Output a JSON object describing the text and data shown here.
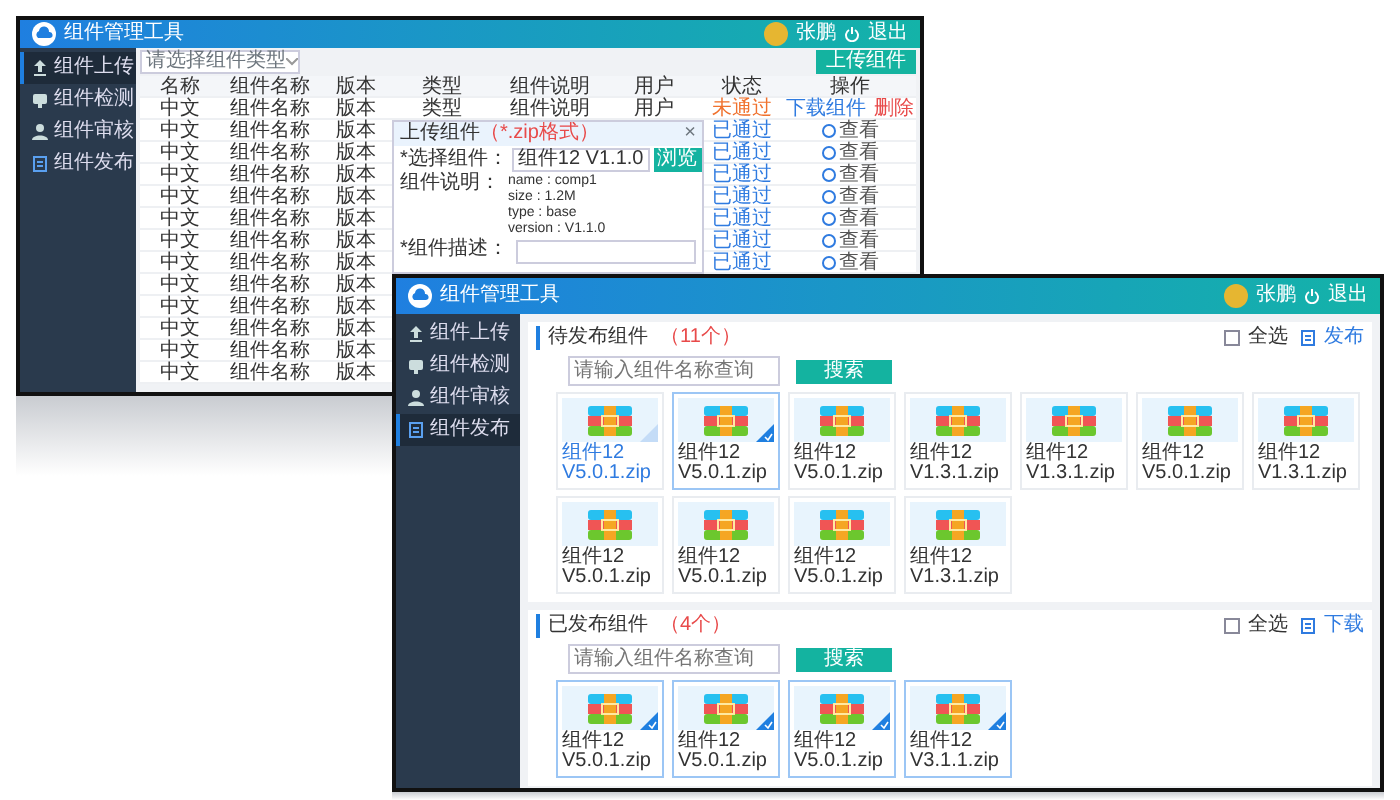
{
  "back_window": {
    "title": "组件管理工具",
    "user": "张鹏",
    "logout": "退出",
    "sidebar": [
      {
        "label": "组件上传",
        "selected": true
      },
      {
        "label": "组件检测",
        "selected": false
      },
      {
        "label": "组件审核",
        "selected": false
      },
      {
        "label": "组件发布",
        "selected": false
      }
    ],
    "filter": {
      "placeholder": "请选择组件类型"
    },
    "upload_button": "上传组件",
    "table": {
      "columns": [
        "名称",
        "组件名称",
        "版本",
        "类型",
        "组件说明",
        "用户",
        "状态",
        "操作"
      ],
      "rows": [
        {
          "no": "中文",
          "name": "组件名称",
          "version": "版本",
          "type": "类型",
          "desc": "组件说明",
          "user": "用户",
          "status": "未通过",
          "passed": false,
          "actions": [
            {
              "label": "下载组件",
              "kind": "link"
            },
            {
              "label": "删除",
              "kind": "danger"
            }
          ]
        },
        {
          "no": "中文",
          "name": "组件名称",
          "version": "版本",
          "status": "已通过",
          "passed": true,
          "actions": [
            {
              "label": "查看",
              "kind": "view"
            }
          ]
        },
        {
          "no": "中文",
          "name": "组件名称",
          "version": "版本",
          "status": "已通过",
          "passed": true,
          "actions": [
            {
              "label": "查看",
              "kind": "view"
            }
          ]
        },
        {
          "no": "中文",
          "name": "组件名称",
          "version": "版本",
          "status": "已通过",
          "passed": true,
          "actions": [
            {
              "label": "查看",
              "kind": "view"
            }
          ]
        },
        {
          "no": "中文",
          "name": "组件名称",
          "version": "版本",
          "status": "已通过",
          "passed": true,
          "actions": [
            {
              "label": "查看",
              "kind": "view"
            }
          ]
        },
        {
          "no": "中文",
          "name": "组件名称",
          "version": "版本",
          "status": "已通过",
          "passed": true,
          "actions": [
            {
              "label": "查看",
              "kind": "view"
            }
          ]
        },
        {
          "no": "中文",
          "name": "组件名称",
          "version": "版本",
          "status": "已通过",
          "passed": true,
          "actions": [
            {
              "label": "查看",
              "kind": "view"
            }
          ]
        },
        {
          "no": "中文",
          "name": "组件名称",
          "version": "版本",
          "status": "已通过",
          "passed": true,
          "actions": [
            {
              "label": "查看",
              "kind": "view"
            }
          ]
        },
        {
          "no": "中文",
          "name": "组件名称",
          "version": "版本"
        },
        {
          "no": "中文",
          "name": "组件名称",
          "version": "版本"
        },
        {
          "no": "中文",
          "name": "组件名称",
          "version": "版本"
        },
        {
          "no": "中文",
          "name": "组件名称",
          "version": "版本"
        },
        {
          "no": "中文",
          "name": "组件名称",
          "version": "版本"
        }
      ]
    },
    "dialog": {
      "title": "上传组件",
      "hint": "（*.zip格式）",
      "close": "×",
      "file_label": "*选择组件：",
      "file_value": "组件12 V1.1.0",
      "browse": "浏览",
      "info_label": "组件说明：",
      "info_lines": [
        "name : comp1",
        "size : 1.2M",
        "type : base",
        "version : V1.1.0"
      ],
      "desc_label": "*组件描述："
    }
  },
  "front_window": {
    "title": "组件管理工具",
    "user": "张鹏",
    "logout": "退出",
    "sidebar": [
      {
        "label": "组件上传",
        "selected": false
      },
      {
        "label": "组件检测",
        "selected": false
      },
      {
        "label": "组件审核",
        "selected": false
      },
      {
        "label": "组件发布",
        "selected": true
      }
    ],
    "sections": [
      {
        "title": "待发布组件",
        "count": "（11个）",
        "select_all": {
          "label": "全选",
          "checked": false
        },
        "action": "发布",
        "search": {
          "placeholder": "请输入组件名称查询"
        },
        "search_button": "搜索",
        "items": [
          {
            "label": "组件12 V5.0.1.zip",
            "hovered": true,
            "selected": false
          },
          {
            "label": "组件12 V5.0.1.zip",
            "hovered": false,
            "selected": true
          },
          {
            "label": "组件12 V5.0.1.zip",
            "hovered": false,
            "selected": false
          },
          {
            "label": "组件12 V1.3.1.zip",
            "hovered": false,
            "selected": false
          },
          {
            "label": "组件12 V1.3.1.zip",
            "hovered": false,
            "selected": false
          },
          {
            "label": "组件12 V5.0.1.zip",
            "hovered": false,
            "selected": false
          },
          {
            "label": "组件12 V1.3.1.zip",
            "hovered": false,
            "selected": false
          },
          {
            "label": "组件12 V5.0.1.zip",
            "hovered": false,
            "selected": false
          },
          {
            "label": "组件12 V5.0.1.zip",
            "hovered": false,
            "selected": false
          },
          {
            "label": "组件12 V5.0.1.zip",
            "hovered": false,
            "selected": false
          },
          {
            "label": "组件12 V1.3.1.zip",
            "hovered": false,
            "selected": false
          }
        ]
      },
      {
        "title": "已发布组件",
        "count": "（4个）",
        "select_all": {
          "label": "全选",
          "checked": false
        },
        "action": "下载",
        "search": {
          "placeholder": "请输入组件名称查询"
        },
        "search_button": "搜索",
        "items": [
          {
            "label": "组件12 V5.0.1.zip",
            "hovered": false,
            "selected": true
          },
          {
            "label": "组件12 V5.0.1.zip",
            "hovered": false,
            "selected": true
          },
          {
            "label": "组件12 V5.0.1.zip",
            "hovered": false,
            "selected": true
          },
          {
            "label": "组件12 V3.1.1.zip",
            "hovered": false,
            "selected": true
          }
        ]
      }
    ]
  }
}
